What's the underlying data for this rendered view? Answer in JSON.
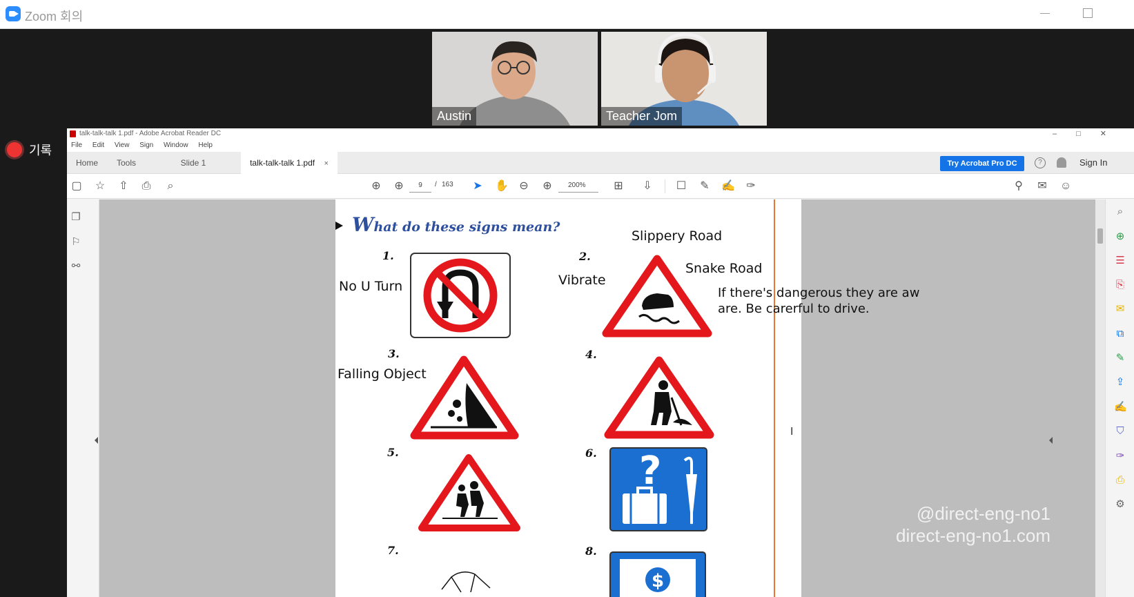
{
  "zoom": {
    "window_title": "Zoom 회의",
    "participants": [
      {
        "name": "Austin"
      },
      {
        "name": "Teacher Jom"
      }
    ],
    "record_label": "기록"
  },
  "acrobat": {
    "window_title": "talk-talk-talk 1.pdf - Adobe Acrobat Reader DC",
    "menu": [
      "File",
      "Edit",
      "View",
      "Sign",
      "Window",
      "Help"
    ],
    "tabs": {
      "home": "Home",
      "tools": "Tools",
      "slide": "Slide 1",
      "document": "talk-talk-talk 1.pdf",
      "close": "×"
    },
    "try_button": "Try Acrobat Pro DC",
    "sign_in": "Sign In",
    "page_current": "9",
    "page_sep": "/",
    "page_total": "163",
    "zoom_level": "200%"
  },
  "document": {
    "heading_initial": "W",
    "heading_rest": "hat do these signs mean?",
    "numbers": [
      "1.",
      "2.",
      "3.",
      "4.",
      "5.",
      "6.",
      "7.",
      "8."
    ],
    "annotations": {
      "slippery": "Slippery Road",
      "snake": "Snake Road",
      "no_u_turn": "No U Turn",
      "vibrate": "Vibrate",
      "dangerous_1": "If there's dangerous they are aw",
      "dangerous_2": "are. Be carerful to drive.",
      "falling": "Falling Object"
    }
  },
  "watermark": {
    "line1": "@direct-eng-no1",
    "line2": "direct-eng-no1.com"
  },
  "colors": {
    "zoom_blue": "#2d8cff",
    "acrobat_blue": "#1473e6",
    "sign_red": "#e3171c",
    "sign_blue": "#1a6fd1",
    "heading_blue": "#2d4f9d",
    "divider_orange": "#e8772c"
  }
}
